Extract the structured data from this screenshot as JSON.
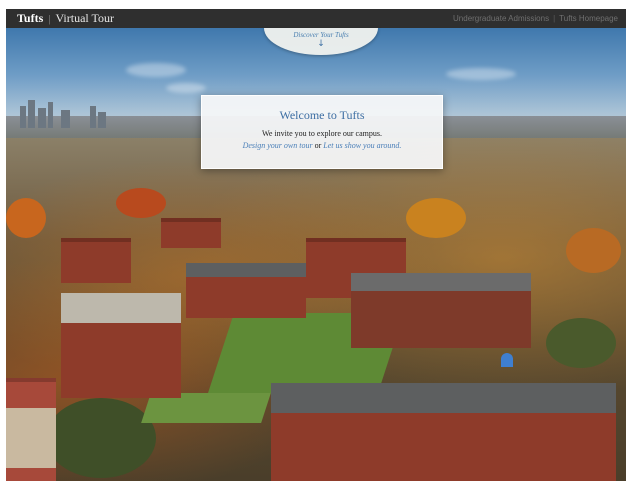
{
  "header": {
    "brand": "Tufts",
    "separator": "|",
    "title": "Virtual Tour",
    "links": [
      {
        "label": "Undergraduate Admissions"
      },
      {
        "label": "Tufts Homepage"
      }
    ],
    "link_separator": "|"
  },
  "discover": {
    "label": "Discover Your Tufts",
    "icon": "down-arrow-icon"
  },
  "welcome": {
    "title": "Welcome to Tufts",
    "text": "We invite you to explore our campus.",
    "link_design": "Design your own tour",
    "conjunction": "or",
    "link_show": "Let us show you around."
  },
  "colors": {
    "topbar": "#2f2f2f",
    "accent": "#3d6ea3",
    "link": "#4a7fb8"
  }
}
